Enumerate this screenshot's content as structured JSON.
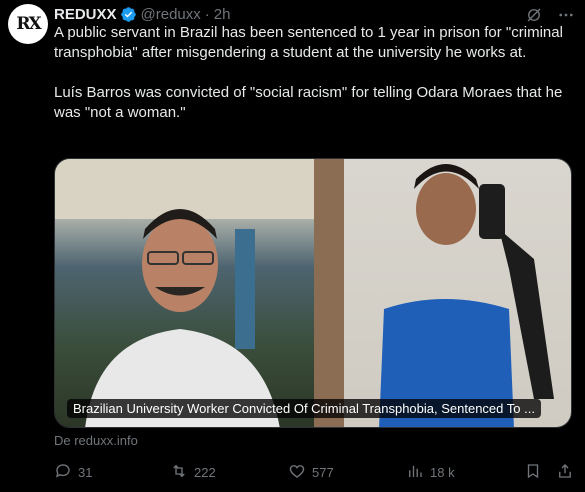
{
  "author": {
    "avatar_text": "RX",
    "name": "REDUXX",
    "handle": "@reduxx",
    "separator": "·",
    "time": "2h"
  },
  "tweet": {
    "paragraph1": "A public servant in Brazil has been sentenced to 1 year in prison for \"criminal transphobia\" after misgendering a student at the university he works at.",
    "paragraph2": "Luís Barros was convicted of \"social racism\" for telling Odara Moraes that he was \"not a woman.\""
  },
  "card": {
    "caption": "Brazilian University Worker Convicted Of Criminal Transphobia, Sentenced To ...",
    "source": "De reduxx.info"
  },
  "actions": {
    "replies": "31",
    "reposts": "222",
    "likes": "577",
    "views": "18 k"
  },
  "colors": {
    "background": "#000000",
    "text": "#e7e9ea",
    "muted": "#71767b",
    "verified": "#1d9bf0"
  },
  "icons": [
    "verified-icon",
    "grok-icon",
    "more-icon",
    "reply-icon",
    "repost-icon",
    "like-icon",
    "views-icon",
    "bookmark-icon",
    "share-icon"
  ]
}
